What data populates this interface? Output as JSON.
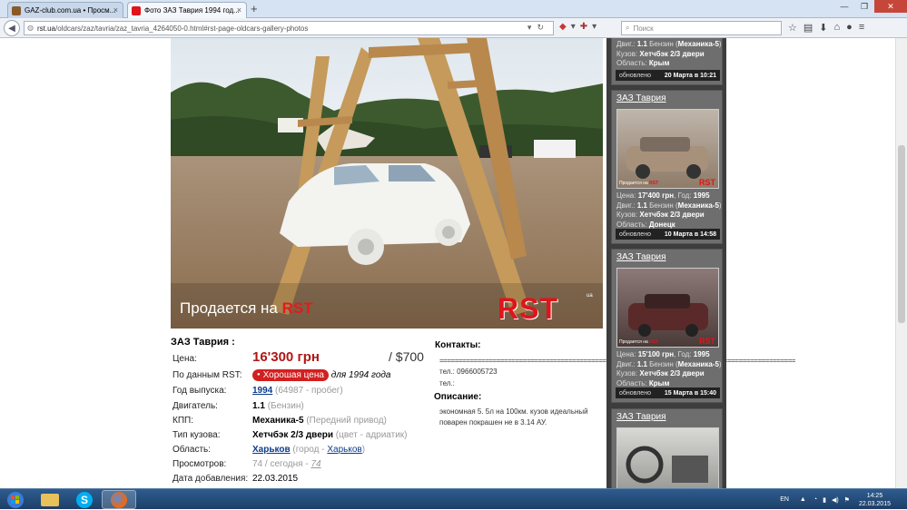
{
  "browser": {
    "tabs": [
      {
        "title": "GAZ-club.com.ua • Просм...",
        "active": false
      },
      {
        "title": "Фото ЗАЗ Таврия 1994 год...",
        "active": true
      }
    ],
    "url_prefix": "rst.ua",
    "url_rest": "/oldcars/zaz/tavria/zaz_tavria_4264050-0.html#rst-page-oldcars-gallery-photos",
    "search_placeholder": "Поиск"
  },
  "photo": {
    "caption_prefix": "Продается на ",
    "caption_brand": "RST",
    "logo": "RST",
    "logo_sup": "ua"
  },
  "listing": {
    "title": "ЗАЗ Таврия :",
    "price_label": "Цена:",
    "price_uah": "16'300 грн",
    "price_usd": "/ $700",
    "rst_label": "По данным RST:",
    "rst_badge": "Хорошая цена",
    "rst_note": "для 1994 года",
    "year_label": "Год выпуска:",
    "year": "1994",
    "mileage": "(64987 - пробег)",
    "engine_label": "Двигатель:",
    "engine": "1.1",
    "fuel": "(Бензин)",
    "gearbox_label": "КПП:",
    "gearbox": "Механика-5",
    "drive": "(Передний привод)",
    "body_label": "Тип кузова:",
    "body": "Хетчбэк 2/3 двери",
    "color": "(цвет - адриатик)",
    "region_label": "Область:",
    "region": "Харьков",
    "city_prefix": "(город - ",
    "city": "Харьков",
    "city_suffix": ")",
    "views_label": "Просмотров:",
    "views_total": "74 / сегодня - ",
    "views_today": "74",
    "added_label": "Дата добавления:",
    "added_date": "22.03.2015"
  },
  "contacts": {
    "heading": "Контакты:",
    "separator": "==================================================================================================",
    "tel1": "тел.: 0966005723",
    "tel2": "тел.:",
    "desc_heading": "Описание:",
    "description": "экономная 5. 5л на 100км. кузов идеальный поварен покрашен не в 3.14 АУ."
  },
  "sidebar": {
    "top_partial": {
      "line1_label": "Двиг.:",
      "line1_val": "1.1",
      "line1_rest": " Бензин (",
      "line1_gear": "Механика-5",
      "line1_end": ")",
      "line2_label": "Кузов:",
      "line2_val": "Хетчбэк 2/3 двери",
      "line3_label": "Область:",
      "line3_val": "Крым",
      "updated": "обновлено",
      "date": "20 Марта в 10:21"
    },
    "cards": [
      {
        "title": "ЗАЗ Таврия",
        "thumb_label": "Продается на ",
        "thumb_brand": "RST",
        "thumb_logo": "RST",
        "price_label": "Цена:",
        "price": "17'400 грн",
        "year_label": ", Год:",
        "year": "1995",
        "engine_label": "Двиг.:",
        "engine": "1.1",
        "fuel": " Бензин (",
        "gear": "Механика-5",
        "gear_end": ")",
        "body_label": "Кузов:",
        "body": "Хетчбэк 2/3 двери",
        "region_label": "Область:",
        "region": "Донецк",
        "updated": "обновлено",
        "date": "10 Марта в 14:58"
      },
      {
        "title": "ЗАЗ Таврия",
        "thumb_label": "Продается на ",
        "thumb_brand": "RST",
        "thumb_logo": "RST",
        "price_label": "Цена:",
        "price": "15'100 грн",
        "year_label": ", Год:",
        "year": "1995",
        "engine_label": "Двиг.:",
        "engine": "1.1",
        "fuel": " Бензин (",
        "gear": "Механика-5",
        "gear_end": ")",
        "body_label": "Кузов:",
        "body": "Хетчбэк 2/3 двери",
        "region_label": "Область:",
        "region": "Крым",
        "updated": "обновлено",
        "date": "15 Марта в 15:40"
      },
      {
        "title": "ЗАЗ Таврия"
      }
    ]
  },
  "taskbar": {
    "lang": "EN",
    "time": "14:25",
    "date": "22.03.2015"
  },
  "colors": {
    "accent_red": "#e0141a",
    "sidebar_bg": "#3d3d3d",
    "link_blue": "#0b3b8a"
  }
}
